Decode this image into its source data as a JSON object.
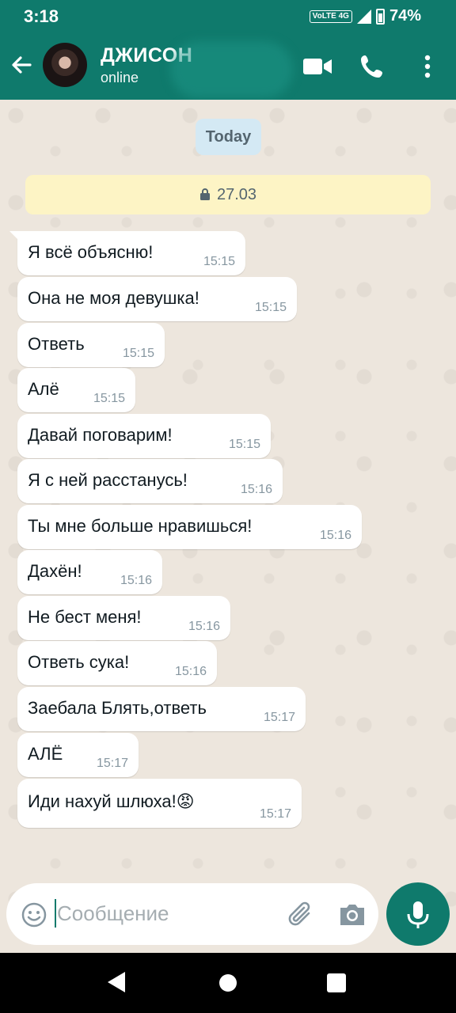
{
  "status_bar": {
    "time": "3:18",
    "network": "VoLTE 4G",
    "battery": "74%"
  },
  "header": {
    "contact_name": "ДЖИСОН",
    "contact_status": "online",
    "icons": [
      "back-arrow-icon",
      "avatar",
      "video-call-icon",
      "phone-call-icon",
      "more-vertical-icon"
    ]
  },
  "chat": {
    "date_chip": "Today",
    "encryption_notice": "27.03",
    "messages": [
      {
        "text": "Я всё объясню!",
        "time": "15:15"
      },
      {
        "text": "Она не моя девушка!",
        "time": "15:15"
      },
      {
        "text": "Ответь",
        "time": "15:15"
      },
      {
        "text": "Алё",
        "time": "15:15"
      },
      {
        "text": "Давай поговарим!",
        "time": "15:15"
      },
      {
        "text": "Я с ней расстанусь!",
        "time": "15:16"
      },
      {
        "text": "Ты мне больше нравишься!",
        "time": "15:16"
      },
      {
        "text": "Дахён!",
        "time": "15:16"
      },
      {
        "text": "Не бест меня!",
        "time": "15:16"
      },
      {
        "text": "Ответь сука!",
        "time": "15:16"
      },
      {
        "text": "Заебала Блять,ответь",
        "time": "15:17"
      },
      {
        "text": "АЛЁ",
        "time": "15:17"
      },
      {
        "text": "Иди нахуй шлюха!😡",
        "time": "15:17"
      }
    ]
  },
  "composer": {
    "placeholder": "Сообщение",
    "icons": [
      "emoji-icon",
      "attach-icon",
      "camera-icon",
      "mic-icon"
    ]
  },
  "colors": {
    "header": "#0f7a6c",
    "chat_bg": "#ede6dd",
    "bubble": "#ffffff",
    "date_chip": "#d4e9f4",
    "notice": "#fdf4c5"
  }
}
